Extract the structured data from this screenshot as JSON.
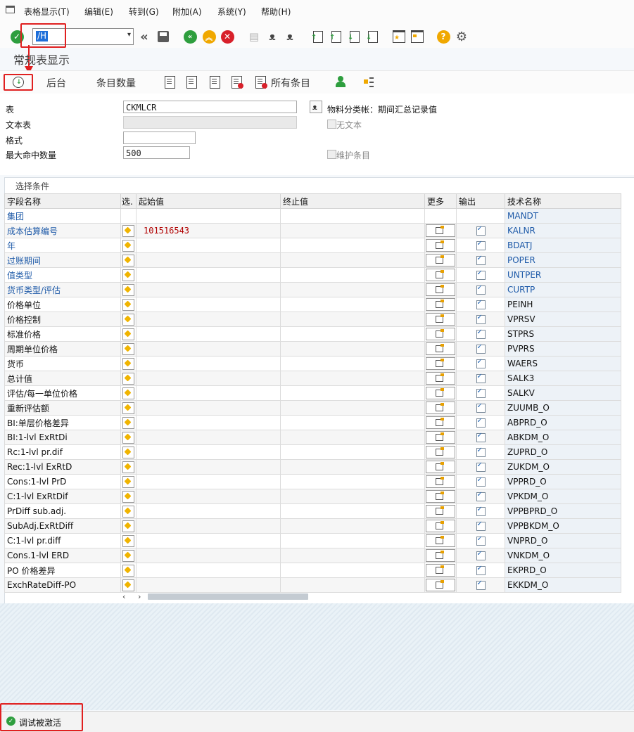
{
  "menu": {
    "items": [
      "表格显示(T)",
      "编辑(E)",
      "转到(G)",
      "附加(A)",
      "系统(Y)",
      "帮助(H)"
    ]
  },
  "toolbar": {
    "command_value": "/H"
  },
  "title": "常规表显示",
  "app_toolbar": {
    "background_label": "后台",
    "entry_count_label": "条目数量",
    "all_entries_label": "所有条目"
  },
  "form": {
    "table_label": "表",
    "table_value": "CKMLCR",
    "text_table_label": "文本表",
    "format_label": "格式",
    "max_hits_label": "最大命中数量",
    "max_hits_value": "500",
    "table_description": "物料分类帐：期间汇总记录值",
    "no_text_label": "无文本",
    "maintain_entries_label": "维护条目"
  },
  "selection": {
    "section_title": "选择条件",
    "columns": {
      "field_name": "字段名称",
      "option": "选.",
      "from_value": "起始值",
      "to_value": "终止值",
      "more": "更多",
      "output": "输出",
      "tech_name": "技术名称"
    },
    "rows": [
      {
        "name": "集团",
        "tech": "MANDT",
        "key": true,
        "from": "",
        "editable": false
      },
      {
        "name": "成本估算编号",
        "tech": "KALNR",
        "key": true,
        "from": "101516543",
        "editable": true
      },
      {
        "name": "年",
        "tech": "BDATJ",
        "key": true,
        "from": "",
        "editable": true
      },
      {
        "name": "过账期间",
        "tech": "POPER",
        "key": true,
        "from": "",
        "editable": true
      },
      {
        "name": "值类型",
        "tech": "UNTPER",
        "key": true,
        "from": "",
        "editable": true
      },
      {
        "name": "货币类型/评估",
        "tech": "CURTP",
        "key": true,
        "from": "",
        "editable": true
      },
      {
        "name": "价格单位",
        "tech": "PEINH",
        "key": false,
        "from": "",
        "editable": true
      },
      {
        "name": "价格控制",
        "tech": "VPRSV",
        "key": false,
        "from": "",
        "editable": true
      },
      {
        "name": "标准价格",
        "tech": "STPRS",
        "key": false,
        "from": "",
        "editable": true
      },
      {
        "name": "周期单位价格",
        "tech": "PVPRS",
        "key": false,
        "from": "",
        "editable": true
      },
      {
        "name": "货币",
        "tech": "WAERS",
        "key": false,
        "from": "",
        "editable": true
      },
      {
        "name": "总计值",
        "tech": "SALK3",
        "key": false,
        "from": "",
        "editable": true
      },
      {
        "name": "评估/每一单位价格",
        "tech": "SALKV",
        "key": false,
        "from": "",
        "editable": true
      },
      {
        "name": "重新评估额",
        "tech": "ZUUMB_O",
        "key": false,
        "from": "",
        "editable": true
      },
      {
        "name": "BI:单层价格差异",
        "tech": "ABPRD_O",
        "key": false,
        "from": "",
        "editable": true
      },
      {
        "name": "BI:1-lvl ExRtDi",
        "tech": "ABKDM_O",
        "key": false,
        "from": "",
        "editable": true
      },
      {
        "name": "Rc:1-lvl pr.dif",
        "tech": "ZUPRD_O",
        "key": false,
        "from": "",
        "editable": true
      },
      {
        "name": "Rec:1-lvl ExRtD",
        "tech": "ZUKDM_O",
        "key": false,
        "from": "",
        "editable": true
      },
      {
        "name": "Cons:1-lvl PrD",
        "tech": "VPPRD_O",
        "key": false,
        "from": "",
        "editable": true
      },
      {
        "name": "C:1-lvl ExRtDif",
        "tech": "VPKDM_O",
        "key": false,
        "from": "",
        "editable": true
      },
      {
        "name": "PrDiff sub.adj.",
        "tech": "VPPBPRD_O",
        "key": false,
        "from": "",
        "editable": true
      },
      {
        "name": "SubAdj.ExRtDiff",
        "tech": "VPPBKDM_O",
        "key": false,
        "from": "",
        "editable": true
      },
      {
        "name": "C:1-lvl pr.diff",
        "tech": "VNPRD_O",
        "key": false,
        "from": "",
        "editable": true
      },
      {
        "name": "Cons.1-lvl ERD",
        "tech": "VNKDM_O",
        "key": false,
        "from": "",
        "editable": true
      },
      {
        "name": "PO 价格差异",
        "tech": "EKPRD_O",
        "key": false,
        "from": "",
        "editable": true
      },
      {
        "name": "ExchRateDiff-PO",
        "tech": "EKKDM_O",
        "key": false,
        "from": "",
        "editable": true
      }
    ]
  },
  "status": {
    "message": "调试被激活"
  },
  "colors": {
    "accent_red": "#e02020",
    "key_field_blue": "#1e5aa8",
    "success_green": "#2e9e3e"
  }
}
